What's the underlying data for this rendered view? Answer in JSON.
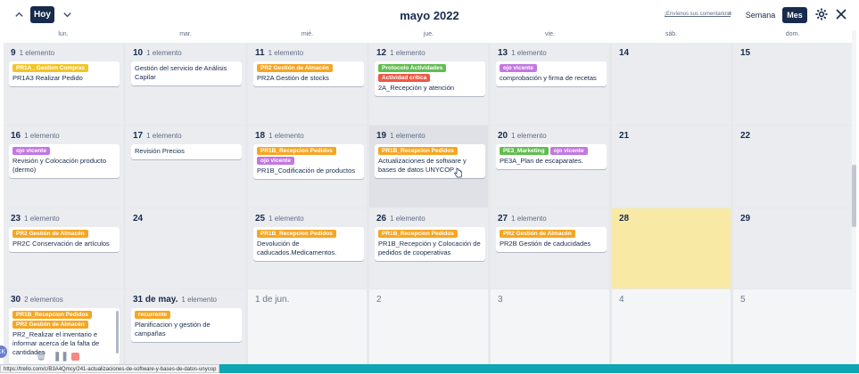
{
  "toolbar": {
    "today_label": "Hoy",
    "title": "mayo 2022",
    "feedback_link": "¡Envíenos sus comentarios!",
    "feedback_close": "×",
    "week_label": "Semana",
    "month_label": "Mes"
  },
  "weekdays": [
    "lun.",
    "mar.",
    "mié.",
    "jue.",
    "vie.",
    "sáb.",
    "dom."
  ],
  "colors": {
    "navy": "#172b4d",
    "yellow": "#f2c526",
    "orange": "#f5a623",
    "purple": "#c377e0",
    "green": "#61bd4f",
    "red": "#eb5a46",
    "today": "#f8eaa5"
  },
  "weeks": [
    [
      {
        "day": "9",
        "count": "1 elemento",
        "cards": [
          {
            "labels": [
              {
                "text": "PR1A_ Gestion Compras",
                "color": "yellow"
              }
            ],
            "title": "PR1A3 Realizar Pedido"
          }
        ]
      },
      {
        "day": "10",
        "count": "1 elemento",
        "cards": [
          {
            "labels": [],
            "title": "Gestión del servicio de Análisis Capilar"
          }
        ]
      },
      {
        "day": "11",
        "count": "1 elemento",
        "cards": [
          {
            "labels": [
              {
                "text": "PR2 Gestión de Almacén",
                "color": "orange"
              }
            ],
            "title": "PR2A Gestión de stocks"
          }
        ]
      },
      {
        "day": "12",
        "count": "1 elemento",
        "cards": [
          {
            "labels": [
              {
                "text": "Protocolo Actividades",
                "color": "green"
              },
              {
                "text": "Actividad crítica",
                "color": "red"
              }
            ],
            "title": "2A_Recepción y atención"
          }
        ]
      },
      {
        "day": "13",
        "count": "1 elemento",
        "cards": [
          {
            "labels": [
              {
                "text": "ojo vicente",
                "color": "purple"
              }
            ],
            "title": "comprobación y firma de recetas"
          }
        ]
      },
      {
        "day": "14",
        "count": "",
        "cards": []
      },
      {
        "day": "15",
        "count": "",
        "cards": []
      }
    ],
    [
      {
        "day": "16",
        "count": "1 elemento",
        "cards": [
          {
            "labels": [
              {
                "text": "ojo vicente",
                "color": "purple"
              }
            ],
            "title": "Revisión y Colocación producto (dermo)"
          }
        ]
      },
      {
        "day": "17",
        "count": "1 elemento",
        "cards": [
          {
            "labels": [],
            "title": "Revisión Precios"
          }
        ]
      },
      {
        "day": "18",
        "count": "1 elemento",
        "cards": [
          {
            "labels": [
              {
                "text": "PR1B_Recepcion Pedidos",
                "color": "orange"
              },
              {
                "text": "ojo vicente",
                "color": "purple"
              }
            ],
            "title": "PR1B_Codificación de productos"
          }
        ]
      },
      {
        "day": "19",
        "count": "1 elemento",
        "cards": [
          {
            "labels": [
              {
                "text": "PR1B_Recepcion Pedidos",
                "color": "orange"
              }
            ],
            "title": "Actualizaciones de software y bases de datos UNYCOP"
          }
        ]
      },
      {
        "day": "20",
        "count": "1 elemento",
        "cards": [
          {
            "labels": [
              {
                "text": "PE3_Marketing",
                "color": "green"
              },
              {
                "text": "ojo vicente",
                "color": "purple"
              }
            ],
            "title": "PE3A_Plan de escaparates."
          }
        ]
      },
      {
        "day": "21",
        "count": "",
        "cards": []
      },
      {
        "day": "22",
        "count": "",
        "cards": []
      }
    ],
    [
      {
        "day": "23",
        "count": "1 elemento",
        "cards": [
          {
            "labels": [
              {
                "text": "PR2 Gestión de Almacén",
                "color": "orange"
              }
            ],
            "title": "PR2C Conservación de artículos"
          }
        ]
      },
      {
        "day": "24",
        "count": "",
        "cards": []
      },
      {
        "day": "25",
        "count": "1 elemento",
        "cards": [
          {
            "labels": [
              {
                "text": "PR1B_Recepcion Pedidos",
                "color": "orange"
              }
            ],
            "title": "Devolución de caducados.Medicamentos."
          }
        ]
      },
      {
        "day": "26",
        "count": "1 elemento",
        "cards": [
          {
            "labels": [
              {
                "text": "PR1B_Recepcion Pedidos",
                "color": "orange"
              }
            ],
            "title": "PR1B_Recepción y Colocación de pedidos de cooperativas"
          }
        ]
      },
      {
        "day": "27",
        "count": "1 elemento",
        "cards": [
          {
            "labels": [
              {
                "text": "PR2 Gestión de Almacén",
                "color": "orange"
              }
            ],
            "title": "PR2B Gestión de caducidades"
          }
        ]
      },
      {
        "day": "28",
        "count": "",
        "cards": []
      },
      {
        "day": "29",
        "count": "",
        "cards": []
      }
    ],
    [
      {
        "day": "30",
        "count": "2 elementos",
        "cards": [
          {
            "labels": [
              {
                "text": "PR1B_Recepcion Pedidos",
                "color": "orange"
              },
              {
                "text": "PR2 Gestión de Almacén",
                "color": "orange"
              }
            ],
            "title": "PR2_Realizar el inventario e informar acerca de la falta de cantidades"
          }
        ]
      },
      {
        "day": "31 de may.",
        "count": "1 elemento",
        "cards": [
          {
            "labels": [
              {
                "text": "recurrente",
                "color": "orange"
              }
            ],
            "title": "Planificacion y gestión de campañas"
          }
        ]
      },
      {
        "day": "1 de jun.",
        "count": "",
        "cards": []
      },
      {
        "day": "2",
        "count": "",
        "cards": []
      },
      {
        "day": "3",
        "count": "",
        "cards": []
      },
      {
        "day": "4",
        "count": "",
        "cards": []
      },
      {
        "day": "5",
        "count": "",
        "cards": []
      }
    ]
  ],
  "status": {
    "url": "https://trello.com/c/B3A4Qmcy/241-actualizaciones-de-software-y-bases-de-datos-unycop",
    "badge": "CK"
  }
}
